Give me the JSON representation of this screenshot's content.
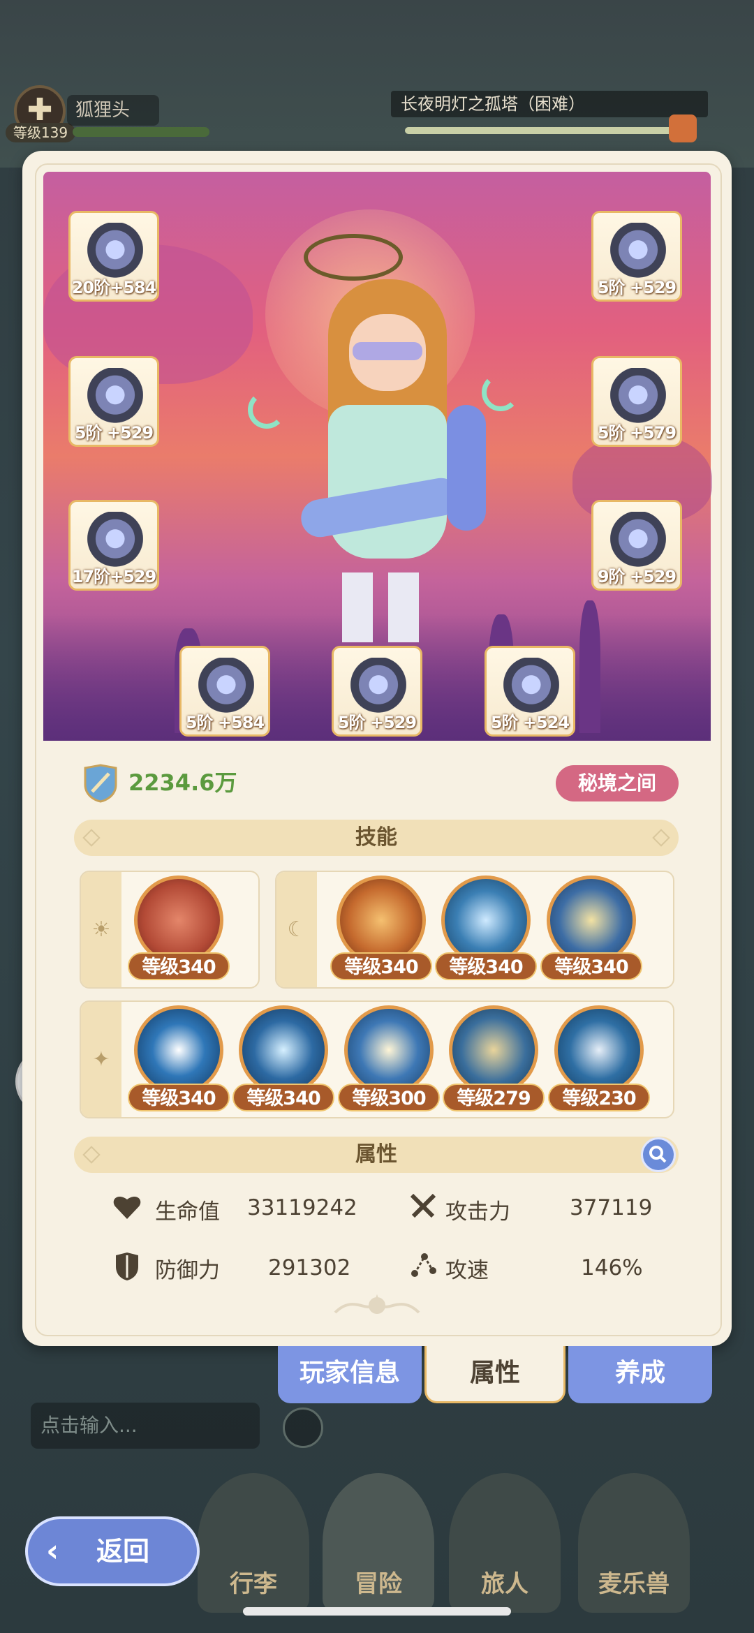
{
  "hud": {
    "player_level": "等级139",
    "player_name": "狐狸头",
    "stage_title": "长夜明灯之孤塔（困难）"
  },
  "equipment": [
    {
      "label": "20阶+584"
    },
    {
      "label": "5阶 +529"
    },
    {
      "label": "5阶 +529"
    },
    {
      "label": "5阶 +579"
    },
    {
      "label": "17阶+529"
    },
    {
      "label": "9阶 +529"
    },
    {
      "label": "5阶 +584"
    },
    {
      "label": "5阶 +529"
    },
    {
      "label": "5阶 +524"
    }
  ],
  "power": "2234.6万",
  "realm_badge": "秘境之间",
  "skills_title": "技能",
  "skills_sun_glyph": "☀",
  "skills_moon_glyph": "☾",
  "skills_star_glyph": "✦",
  "skills": {
    "sun": [
      {
        "level": "等级340",
        "color": "#b34a36"
      }
    ],
    "moon": [
      {
        "level": "等级340",
        "color": "#c56a2e"
      },
      {
        "level": "等级340",
        "color": "#3b7fb4"
      },
      {
        "level": "等级340",
        "color": "#3d6da5"
      }
    ],
    "star": [
      {
        "level": "等级340",
        "color": "#2f77b8"
      },
      {
        "level": "等级340",
        "color": "#2d6aa3"
      },
      {
        "level": "等级300",
        "color": "#3e78b5"
      },
      {
        "level": "等级279",
        "color": "#3a6e9c"
      },
      {
        "level": "等级230",
        "color": "#2f6fa4"
      }
    ]
  },
  "attributes_title": "属性",
  "stats": {
    "hp_label": "生命值",
    "hp_value": "33119242",
    "atk_label": "攻击力",
    "atk_value": "377119",
    "def_label": "防御力",
    "def_value": "291302",
    "spd_label": "攻速",
    "spd_value": "146%"
  },
  "tabs": {
    "player_info": "玩家信息",
    "attributes": "属性",
    "develop": "养成"
  },
  "chat_placeholder": "点击输入...",
  "back_label": "返回",
  "nav": {
    "bag": "行李",
    "adventure": "冒险",
    "traveler": "旅人",
    "beast": "麦乐兽"
  },
  "colors": {
    "accent_gold": "#e8b865",
    "tab_blue": "#7d95e3",
    "power_green": "#5b9a3e",
    "realm_pink": "#d46883"
  }
}
